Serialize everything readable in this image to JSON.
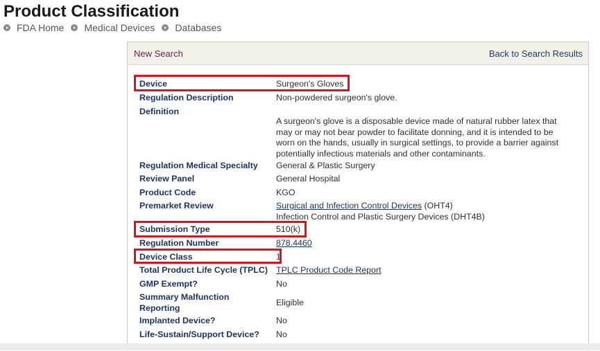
{
  "page": {
    "title": "Product Classification",
    "breadcrumb": [
      "FDA Home",
      "Medical Devices",
      "Databases"
    ]
  },
  "panel": {
    "new_search": "New Search",
    "back_to_results": "Back to Search Results"
  },
  "fields": {
    "device": {
      "label": "Device",
      "value": "Surgeon's Gloves"
    },
    "regulation_description": {
      "label": "Regulation Description",
      "value": "Non-powdered surgeon's glove."
    },
    "definition": {
      "label": "Definition",
      "value": "A surgeon's glove is a disposable device made of natural rubber latex that may or may not bear powder to facilitate donning, and it is intended to be worn on the hands, usually in surgical settings, to provide a barrier against potentially infectious materials and other contaminants."
    },
    "regulation_medical_specialty": {
      "label": "Regulation Medical Specialty",
      "value": "General & Plastic Surgery"
    },
    "review_panel": {
      "label": "Review Panel",
      "value": "General Hospital"
    },
    "product_code": {
      "label": "Product Code",
      "value": "KGO"
    },
    "premarket_review": {
      "label": "Premarket Review",
      "link": "Surgical and Infection Control Devices",
      "link_suffix": " (OHT4)",
      "line2": "Infection Control and Plastic Surgery Devices (DHT4B)"
    },
    "submission_type": {
      "label": "Submission Type",
      "value": "510(k)"
    },
    "regulation_number": {
      "label": "Regulation Number",
      "value": "878.4460"
    },
    "device_class": {
      "label": "Device Class",
      "value": "1"
    },
    "tplc": {
      "label": "Total Product Life Cycle (TPLC)",
      "value": "TPLC Product Code Report"
    },
    "gmp_exempt": {
      "label": "GMP Exempt?",
      "value": "No"
    },
    "summary_malfunction": {
      "label": "Summary Malfunction Reporting",
      "value": "Eligible"
    },
    "implanted_device": {
      "label": "Implanted Device?",
      "value": "No"
    },
    "life_sustain": {
      "label": "Life-Sustain/Support Device?",
      "value": "No"
    }
  },
  "colors": {
    "highlight": "#e0101b",
    "label_text": "#1c3367",
    "header_bg": "#f1f1e8"
  }
}
